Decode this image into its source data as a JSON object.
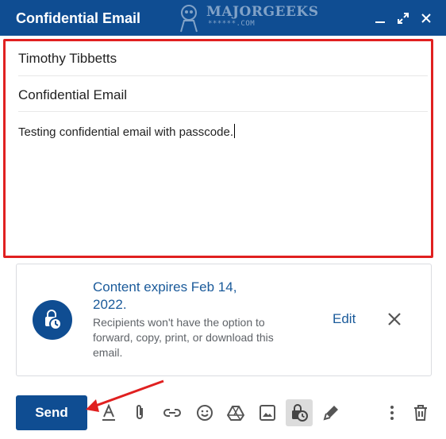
{
  "window": {
    "title": "Confidential Email",
    "controls": [
      "minimize-icon",
      "expand-icon",
      "close-icon"
    ]
  },
  "watermark": {
    "brand": "MAJORGEEKS",
    "sub": "******.COM"
  },
  "compose": {
    "to": "Timothy Tibbetts",
    "subject": "Confidential Email",
    "body": "Testing confidential email with passcode."
  },
  "confidential": {
    "headline": "Content expires Feb 14, 2022.",
    "description": "Recipients won't have the option to forward, copy, print, or download this email.",
    "edit_label": "Edit",
    "icon": "lock-clock-icon"
  },
  "toolbar": {
    "send_label": "Send",
    "icons": [
      "formatting-icon",
      "attach-icon",
      "link-icon",
      "emoji-icon",
      "drive-icon",
      "photo-icon",
      "confidential-mode-icon",
      "signature-icon",
      "more-options-icon",
      "discard-icon"
    ]
  },
  "colors": {
    "header_bg": "#0f4d92",
    "send_bg": "#0f4d92",
    "link_blue": "#1a5a9a",
    "highlight_red": "#e02020",
    "annotation_arrow": "#e02020"
  }
}
